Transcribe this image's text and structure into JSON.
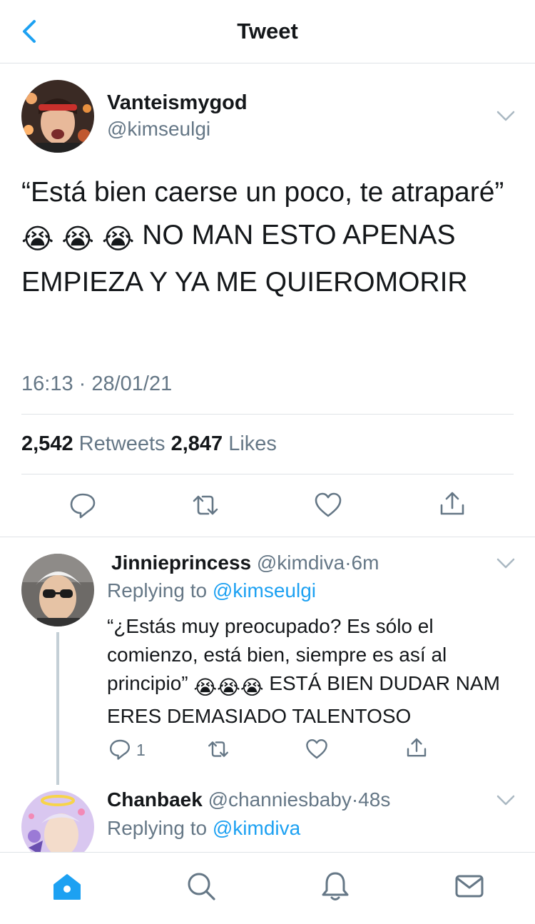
{
  "header": {
    "title": "Tweet"
  },
  "main_tweet": {
    "author_name": "Vanteismygod",
    "author_handle": "@kimseulgi",
    "text_before_emoji": "“Está bien caerse un poco, te atraparé” ",
    "emoji": [
      "😭",
      "😭",
      "😭"
    ],
    "text_after_emoji": " NO MAN ESTO APENAS EMPIEZA Y YA ME QUIEROMORIR",
    "timestamp": "16:13 · 28/01/21",
    "retweet_count": "2,542",
    "retweet_label": "Retweets",
    "like_count": "2,847",
    "like_label": "Likes"
  },
  "replies": [
    {
      "name": "Jinnieprincess",
      "handle": "@kimdiva",
      "sep": "·",
      "age": "6m",
      "replying_label": "Replying to",
      "replying_to": "@kimseulgi",
      "text_before_emoji": "“¿Estás muy preocupado? Es sólo el comienzo, está bien, siempre es así al principio” ",
      "text_after_emoji": " ESTÁ BIEN DUDAR NAM ERES DEMASIADO TALENTOSO",
      "reply_count": "1"
    },
    {
      "name": "Chanbaek",
      "handle": "@channiesbaby",
      "sep": "·",
      "age": "48s",
      "replying_label": "Replying to",
      "replying_to": "@kimdiva"
    }
  ],
  "icons": {
    "back": "chevron-left-icon",
    "more": "chevron-down-icon",
    "reply": "reply-icon",
    "retweet": "retweet-icon",
    "like": "heart-icon",
    "share": "share-icon",
    "home": "home-icon",
    "search": "search-icon",
    "notifications": "bell-icon",
    "messages": "mail-icon"
  },
  "colors": {
    "accent": "#1da1f2",
    "text_primary": "#14171a",
    "text_secondary": "#657786",
    "divider": "#dfe3e7"
  }
}
